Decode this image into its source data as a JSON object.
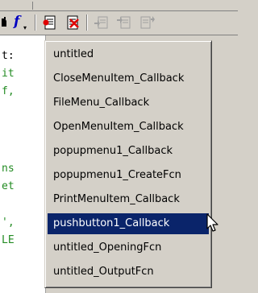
{
  "toolbar": {
    "buttons": [
      {
        "name": "cell-icon"
      },
      {
        "name": "function-icon",
        "label": "f"
      },
      {
        "name": "set-breakpoint-icon"
      },
      {
        "name": "clear-breakpoint-icon"
      },
      {
        "name": "step-icon"
      },
      {
        "name": "step-in-icon"
      },
      {
        "name": "step-out-icon"
      }
    ]
  },
  "editor": {
    "lines": [
      {
        "text": "t:",
        "color": "#000000"
      },
      {
        "text": "it",
        "color": "#228b22"
      },
      {
        "text": "f,",
        "color": "#228b22"
      },
      {
        "text": "ns",
        "color": "#228b22"
      },
      {
        "text": "et",
        "color": "#228b22"
      },
      {
        "text": "',",
        "color": "#228b22"
      },
      {
        "text": "LE",
        "color": "#228b22"
      }
    ]
  },
  "menu": {
    "items": [
      {
        "label": "untitled"
      },
      {
        "label": "CloseMenuItem_Callback"
      },
      {
        "label": "FileMenu_Callback"
      },
      {
        "label": "OpenMenuItem_Callback"
      },
      {
        "label": "popupmenu1_Callback"
      },
      {
        "label": "popupmenu1_CreateFcn"
      },
      {
        "label": "PrintMenuItem_Callback"
      },
      {
        "label": "pushbutton1_Callback",
        "selected": true
      },
      {
        "label": "untitled_OpeningFcn"
      },
      {
        "label": "untitled_OutputFcn"
      }
    ]
  },
  "colors": {
    "selection": "#0a246a",
    "menu_bg": "#d4d0c8",
    "function_icon": "#0000c0"
  }
}
